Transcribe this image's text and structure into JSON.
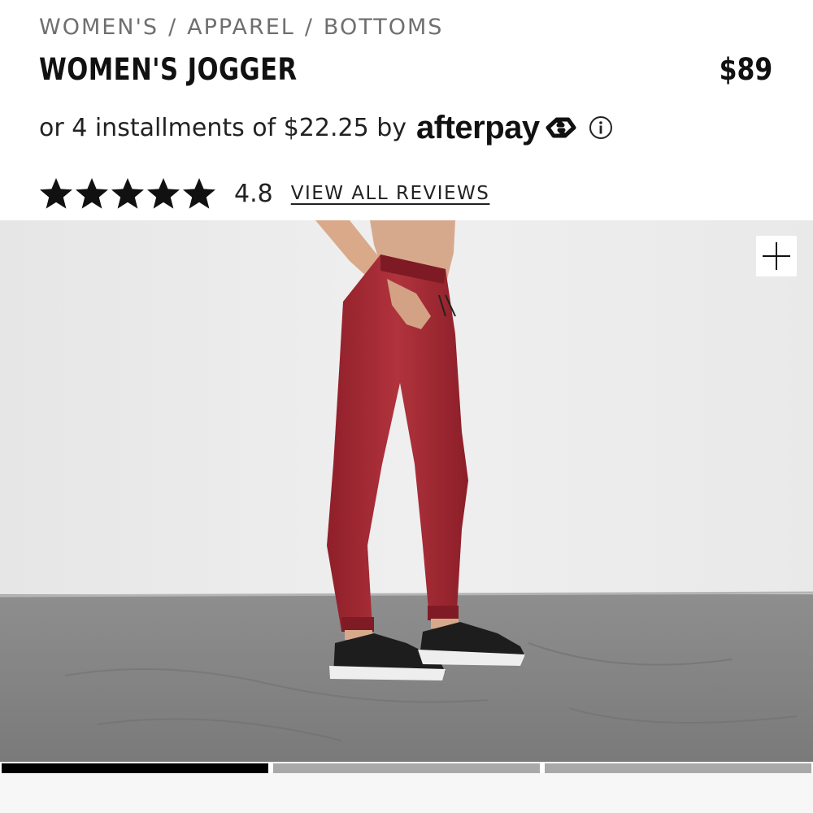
{
  "breadcrumb": {
    "items": [
      "WOMEN'S",
      "APPAREL",
      "BOTTOMS"
    ],
    "separator": "/"
  },
  "product": {
    "title": "WOMEN'S JOGGER",
    "price": "$89"
  },
  "installments": {
    "text": "or 4 installments of $22.25 by",
    "provider": "afterpay",
    "info_icon": "info-circle-icon"
  },
  "rating": {
    "stars": 5,
    "value": "4.8",
    "reviews_link": "VIEW ALL REVIEWS"
  },
  "gallery": {
    "zoom_icon": "plus-icon",
    "indicator_count": 3,
    "active_index": 0
  },
  "colors": {
    "text": "#111111",
    "muted": "#6f6f6f",
    "jogger": "#a32a33",
    "indicator_active": "#000000",
    "indicator_inactive": "#a9a9a9"
  }
}
